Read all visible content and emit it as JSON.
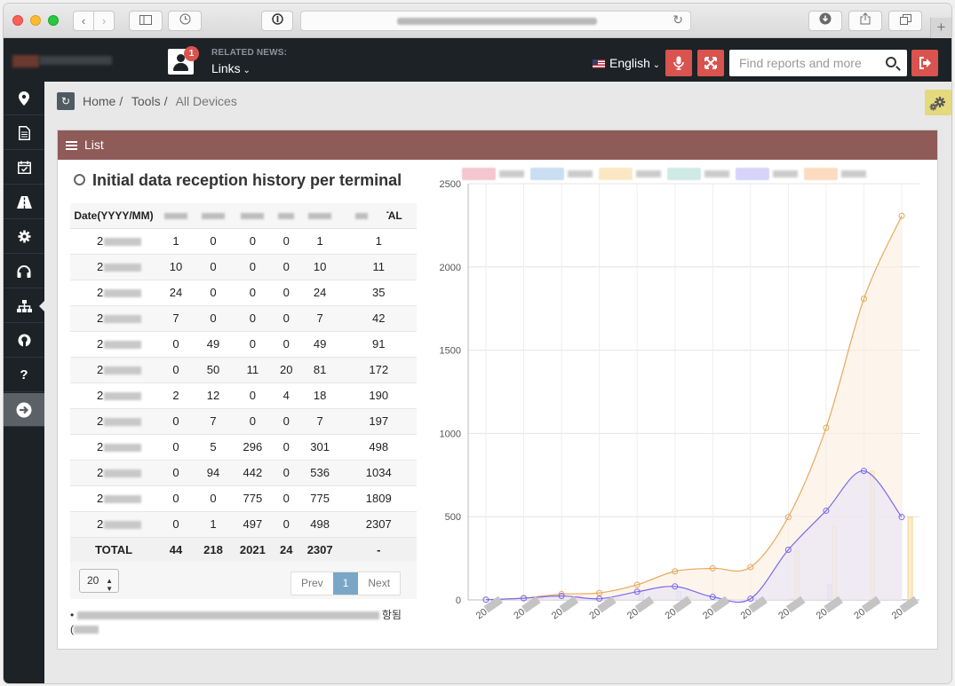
{
  "browser": {
    "add_tab_label": "+"
  },
  "topbar": {
    "notification_count": "1",
    "related_news_label": "RELATED NEWS:",
    "links_label": "Links",
    "language_label": "English",
    "search_placeholder": "Find reports and more"
  },
  "breadcrumb": {
    "items": [
      "Home",
      "Tools",
      "All Devices"
    ]
  },
  "panel": {
    "title": "List",
    "subtitle": "Initial data reception history per terminal"
  },
  "table": {
    "headers": [
      "Date(YYYY/MM)",
      "",
      "",
      "",
      "",
      "",
      "TOTAL"
    ],
    "rows": [
      [
        "2",
        "1",
        "0",
        "0",
        "0",
        "1",
        "1"
      ],
      [
        "2",
        "10",
        "0",
        "0",
        "0",
        "10",
        "11"
      ],
      [
        "2",
        "24",
        "0",
        "0",
        "0",
        "24",
        "35"
      ],
      [
        "2",
        "7",
        "0",
        "0",
        "0",
        "7",
        "42"
      ],
      [
        "2",
        "0",
        "49",
        "0",
        "0",
        "49",
        "91"
      ],
      [
        "2",
        "0",
        "50",
        "11",
        "20",
        "81",
        "172"
      ],
      [
        "2",
        "2",
        "12",
        "0",
        "4",
        "18",
        "190"
      ],
      [
        "2",
        "0",
        "7",
        "0",
        "0",
        "7",
        "197"
      ],
      [
        "2",
        "0",
        "5",
        "296",
        "0",
        "301",
        "498"
      ],
      [
        "2",
        "0",
        "94",
        "442",
        "0",
        "536",
        "1034"
      ],
      [
        "2",
        "0",
        "0",
        "775",
        "0",
        "775",
        "1809"
      ],
      [
        "2",
        "0",
        "1",
        "497",
        "0",
        "498",
        "2307"
      ]
    ],
    "totals": [
      "TOTAL",
      "44",
      "218",
      "2021",
      "24",
      "2307",
      "-"
    ]
  },
  "pagination": {
    "page_size": "20",
    "prev_label": "Prev",
    "current_page": "1",
    "next_label": "Next"
  },
  "note": {
    "bullet": "•",
    "suffix": "항됨",
    "line2_prefix": "("
  },
  "colors": {
    "panel_header": "#8e5b59",
    "danger": "#d9534f",
    "pager_active": "#7aa7c7",
    "orange_line": "#e8a85c",
    "purple_line": "#7b68ee",
    "blue_bar": "#8db9e0"
  },
  "chart_data": {
    "type": "line",
    "ylim": [
      0,
      2500
    ],
    "yticks": [
      0,
      500,
      1000,
      1500,
      2000,
      2500
    ],
    "x_tick_prefix": "20",
    "legend_colors": [
      "#f5c6cf",
      "#c9def2",
      "#fbe7c4",
      "#cfe9e4",
      "#d7d3fa",
      "#fbdcc0"
    ],
    "series": [
      {
        "type": "line",
        "color": "#e8a85c",
        "fill": "#fbeee0",
        "values": [
          1,
          11,
          35,
          42,
          91,
          172,
          190,
          197,
          498,
          1034,
          1809,
          2307
        ]
      },
      {
        "type": "line",
        "color": "#7b68ee",
        "fill": "#e8e4f7",
        "values": [
          1,
          10,
          24,
          7,
          49,
          81,
          18,
          7,
          301,
          536,
          775,
          498
        ]
      },
      {
        "type": "bar",
        "color": "#8db9e0",
        "fill": "#cfe2f3",
        "values": [
          0,
          0,
          0,
          0,
          49,
          50,
          12,
          7,
          5,
          94,
          0,
          1
        ]
      },
      {
        "type": "bar",
        "color": "#f4c77e",
        "fill": "#fdeccb",
        "values": [
          0,
          0,
          0,
          0,
          0,
          11,
          0,
          0,
          296,
          442,
          775,
          497
        ]
      },
      {
        "type": "bar",
        "color": "#7fc9b8",
        "fill": "#d8efe9",
        "values": [
          0,
          0,
          0,
          0,
          0,
          20,
          4,
          0,
          0,
          0,
          0,
          0
        ]
      },
      {
        "type": "bar",
        "color": "#f2a3b3",
        "fill": "#fbdbe2",
        "values": [
          1,
          10,
          24,
          7,
          0,
          0,
          2,
          0,
          0,
          0,
          0,
          0
        ]
      }
    ]
  }
}
